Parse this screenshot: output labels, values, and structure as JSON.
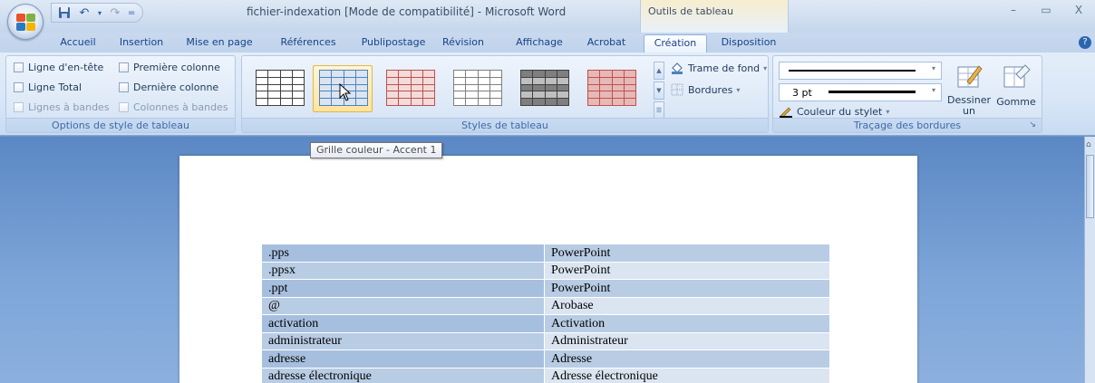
{
  "app": {
    "document_title": "fichier-indexation [Mode de compatibilité] - Microsoft Word",
    "context_tools_label": "Outils de tableau",
    "qat_separator": "=",
    "window_controls": [
      "–",
      "▭",
      "X"
    ],
    "help_label": "?"
  },
  "tabs": [
    {
      "label": "Accueil",
      "active": false
    },
    {
      "label": "Insertion",
      "active": false
    },
    {
      "label": "Mise en page",
      "active": false
    },
    {
      "label": "Références",
      "active": false
    },
    {
      "label": "Publipostage",
      "active": false
    },
    {
      "label": "Révision",
      "active": false
    },
    {
      "label": "Affichage",
      "active": false
    },
    {
      "label": "Acrobat",
      "active": false
    },
    {
      "label": "Création",
      "active": true
    },
    {
      "label": "Disposition",
      "active": false
    }
  ],
  "ribbon": {
    "style_options": {
      "group_label": "Options de style de tableau",
      "checkboxes": [
        {
          "label": "Ligne d'en-tête",
          "checked": false,
          "enabled": true
        },
        {
          "label": "Première colonne",
          "checked": false,
          "enabled": true
        },
        {
          "label": "Ligne Total",
          "checked": false,
          "enabled": true
        },
        {
          "label": "Dernière colonne",
          "checked": false,
          "enabled": true
        },
        {
          "label": "Lignes à bandes",
          "checked": false,
          "enabled": false
        },
        {
          "label": "Colonnes à bandes",
          "checked": false,
          "enabled": false
        }
      ]
    },
    "table_styles": {
      "group_label": "Styles de tableau",
      "tooltip": "Grille couleur - Accent 1",
      "shading_label": "Trame de fond",
      "borders_label": "Bordures",
      "dropdown_arrow": "▾",
      "styles": [
        {
          "name": "plain-grid",
          "color": "#404040",
          "fill": "#ffffff"
        },
        {
          "name": "blue-accent",
          "color": "#4f81bd",
          "fill": "#dbe5f1",
          "selected": true
        },
        {
          "name": "red-accent",
          "color": "#c0504d",
          "fill": "#f2dcdb"
        },
        {
          "name": "gray-light",
          "color": "#7f7f7f",
          "fill": "#ffffff"
        },
        {
          "name": "dark-gray",
          "color": "#404040",
          "fill": "#a6a6a6"
        },
        {
          "name": "red-dark",
          "color": "#c0504d",
          "fill": "#e6b9b8"
        }
      ]
    },
    "borders": {
      "group_label": "Traçage des bordures",
      "pen_weight": "3 pt",
      "pen_color_label": "Couleur du stylet",
      "draw_table_label": "Dessiner un tableau",
      "eraser_label": "Gomme"
    }
  },
  "document": {
    "rows": [
      [
        ".pps",
        "PowerPoint"
      ],
      [
        ".ppsx",
        "PowerPoint"
      ],
      [
        ".ppt",
        "PowerPoint"
      ],
      [
        "@",
        "Arobase"
      ],
      [
        "activation",
        "Activation"
      ],
      [
        "administrateur",
        "Administrateur"
      ],
      [
        "adresse",
        "Adresse"
      ],
      [
        "adresse électronique",
        "Adresse électronique"
      ]
    ]
  },
  "colors": {
    "accent": "#4f81bd",
    "ribbon_bg": "#dce8f7",
    "doc_bg": "#6c95c9"
  }
}
